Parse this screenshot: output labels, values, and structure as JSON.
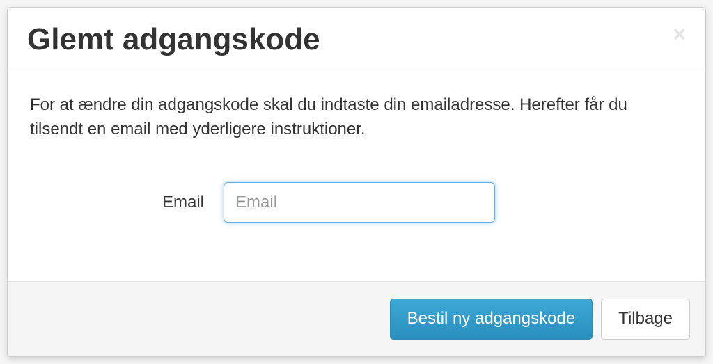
{
  "modal": {
    "title": "Glemt adgangskode",
    "instructions": "For at ændre din adgangskode skal du indtaste din emailadresse. Herefter får du tilsendt en email med yderligere instruktioner.",
    "email_label": "Email",
    "email_placeholder": "Email",
    "email_value": "",
    "submit_label": "Bestil ny adgangskode",
    "back_label": "Tilbage"
  }
}
